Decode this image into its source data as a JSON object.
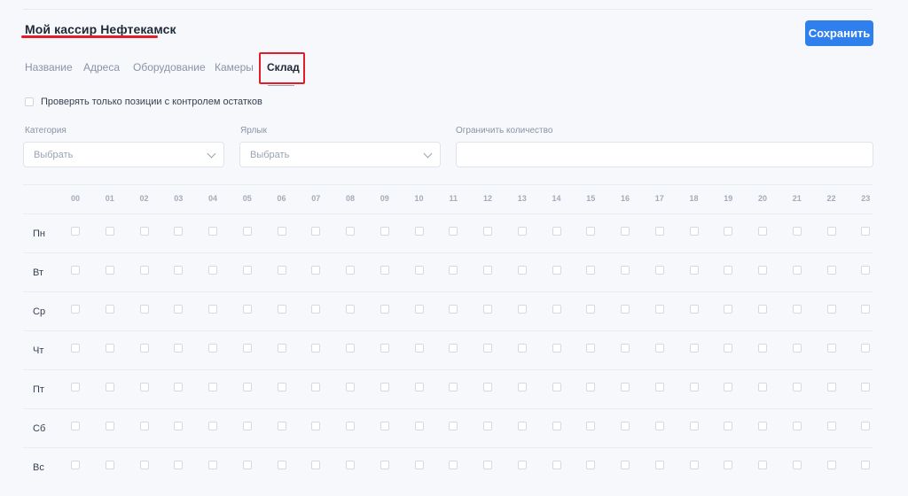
{
  "header": {
    "title": "Мой кассир Нефтекамск",
    "save_label": "Сохранить"
  },
  "tabs": [
    {
      "label": "Название",
      "active": false
    },
    {
      "label": "Адреса",
      "active": false
    },
    {
      "label": "Оборудование",
      "active": false
    },
    {
      "label": "Камеры",
      "active": false
    },
    {
      "label": "Склад",
      "active": true
    }
  ],
  "stock_only_checkbox": {
    "label": "Проверять только позиции с контролем остатков",
    "checked": false
  },
  "filters": {
    "category": {
      "label": "Категория",
      "placeholder": "Выбрать"
    },
    "tag": {
      "label": "Ярлык",
      "placeholder": "Выбрать"
    },
    "limit": {
      "label": "Ограничить количество",
      "value": ""
    }
  },
  "schedule": {
    "hours": [
      "00",
      "01",
      "02",
      "03",
      "04",
      "05",
      "06",
      "07",
      "08",
      "09",
      "10",
      "11",
      "12",
      "13",
      "14",
      "15",
      "16",
      "17",
      "18",
      "19",
      "20",
      "21",
      "22",
      "23"
    ],
    "days": [
      "Пн",
      "Вт",
      "Ср",
      "Чт",
      "Пт",
      "Сб",
      "Вс"
    ]
  },
  "colors": {
    "accent": "#2f80ed",
    "annotation": "#e11d2a"
  }
}
